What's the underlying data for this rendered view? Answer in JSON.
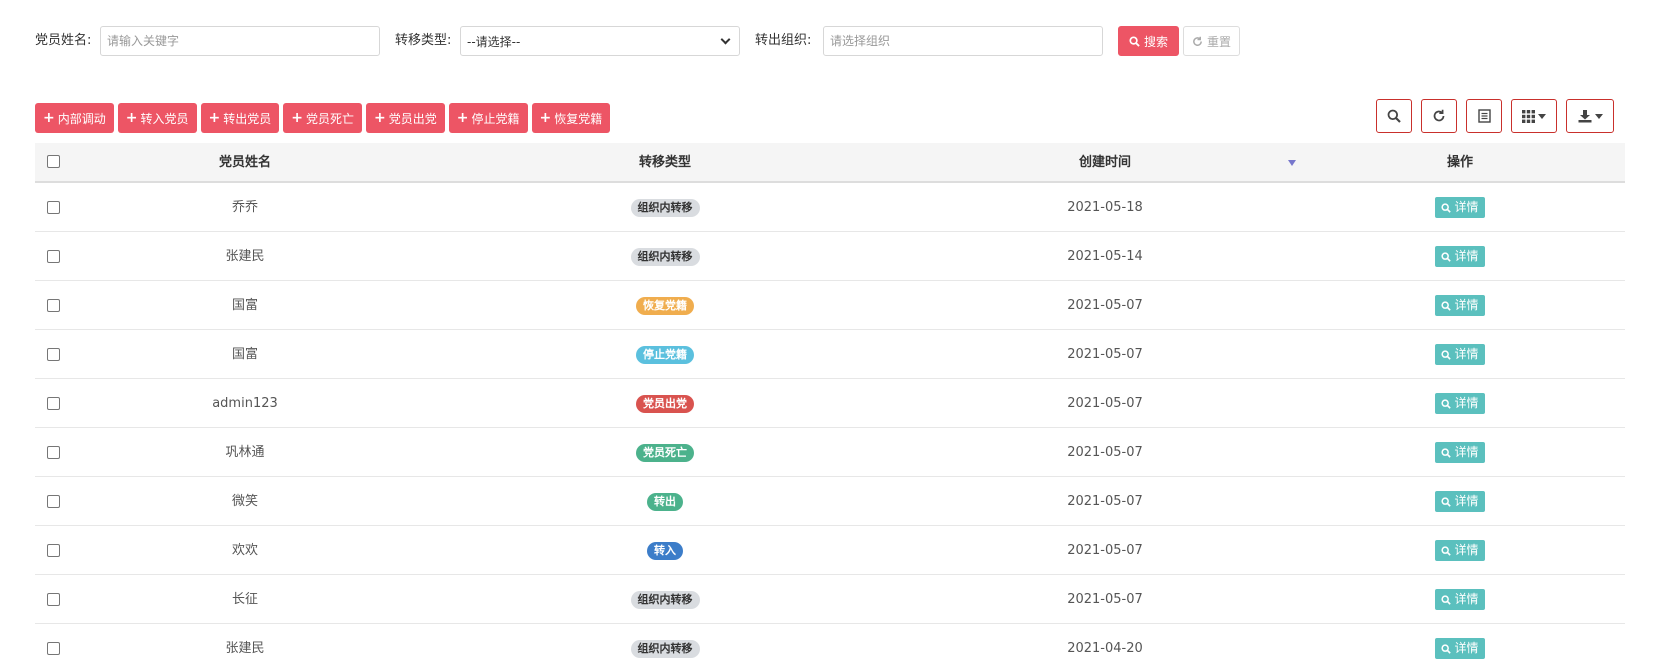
{
  "search": {
    "name_label": "党员姓名:",
    "name_placeholder": "请输入关键字",
    "type_label": "转移类型:",
    "type_selected": "--请选择--",
    "org_label": "转出组织:",
    "org_placeholder": "请选择组织",
    "search_label": "搜索",
    "reset_label": "重置"
  },
  "toolbar": {
    "buttons": [
      "内部调动",
      "转入党员",
      "转出党员",
      "党员死亡",
      "党员出党",
      "停止党籍",
      "恢复党籍"
    ]
  },
  "table": {
    "columns": [
      "党员姓名",
      "转移类型",
      "创建时间",
      "操作"
    ],
    "rows": [
      {
        "name": "乔乔",
        "type": "组织内转移",
        "type_color": "#d9dce0",
        "type_text": "#333333",
        "date": "2021-05-18",
        "action": "详情"
      },
      {
        "name": "张建民",
        "type": "组织内转移",
        "type_color": "#d9dce0",
        "type_text": "#333333",
        "date": "2021-05-14",
        "action": "详情"
      },
      {
        "name": "国富",
        "type": "恢复党籍",
        "type_color": "#f0ad4e",
        "type_text": "#ffffff",
        "date": "2021-05-07",
        "action": "详情"
      },
      {
        "name": "国富",
        "type": "停止党籍",
        "type_color": "#5bc0de",
        "type_text": "#ffffff",
        "date": "2021-05-07",
        "action": "详情"
      },
      {
        "name": "admin123",
        "type": "党员出党",
        "type_color": "#d9534f",
        "type_text": "#ffffff",
        "date": "2021-05-07",
        "action": "详情"
      },
      {
        "name": "巩林通",
        "type": "党员死亡",
        "type_color": "#4cb28c",
        "type_text": "#ffffff",
        "date": "2021-05-07",
        "action": "详情"
      },
      {
        "name": "微笑",
        "type": "转出",
        "type_color": "#4cb28c",
        "type_text": "#ffffff",
        "date": "2021-05-07",
        "action": "详情"
      },
      {
        "name": "欢欢",
        "type": "转入",
        "type_color": "#3c7dc9",
        "type_text": "#ffffff",
        "date": "2021-05-07",
        "action": "详情"
      },
      {
        "name": "长征",
        "type": "组织内转移",
        "type_color": "#d9dce0",
        "type_text": "#333333",
        "date": "2021-05-07",
        "action": "详情"
      },
      {
        "name": "张建民",
        "type": "组织内转移",
        "type_color": "#d9dce0",
        "type_text": "#333333",
        "date": "2021-04-20",
        "action": "详情"
      }
    ]
  },
  "colors": {
    "accent": "#ed5565",
    "detail": "#5bc0be"
  }
}
